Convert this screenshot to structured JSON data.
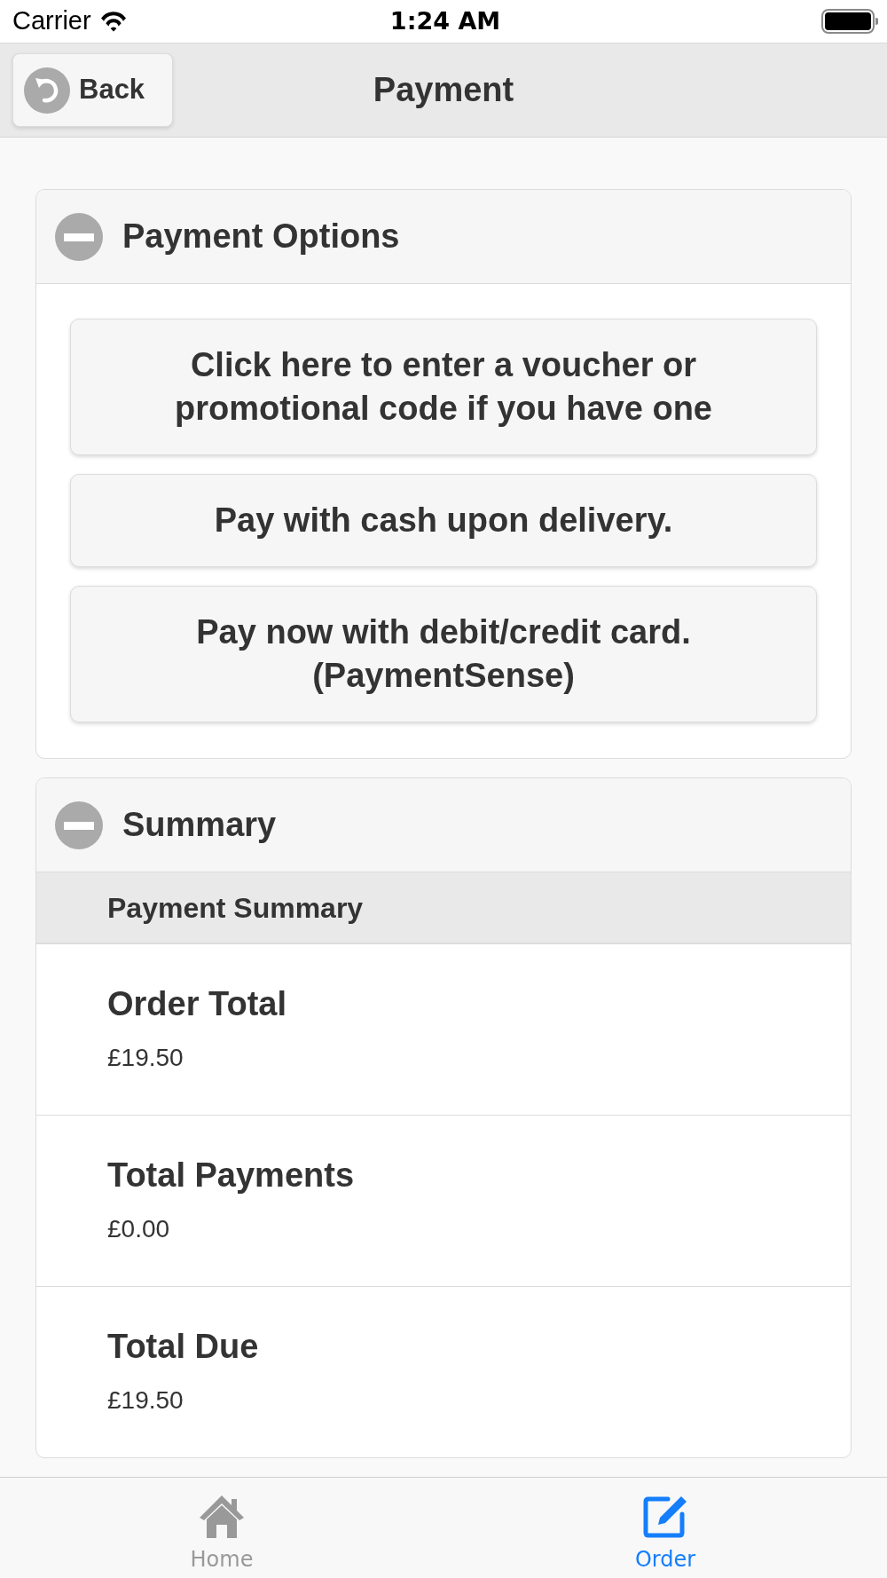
{
  "status_bar": {
    "carrier": "Carrier",
    "time": "1:24 AM"
  },
  "header": {
    "back_button": "Back",
    "title": "Payment"
  },
  "sections": [
    {
      "kind": "buttons",
      "title": "Payment Options",
      "expanded": true,
      "buttons": [
        "Click here to enter a voucher or promotional code if you have one",
        "Pay with cash upon delivery.",
        "Pay now with debit/credit card. (PaymentSense)"
      ]
    },
    {
      "kind": "list",
      "title": "Summary",
      "expanded": true,
      "divider": "Payment Summary",
      "items": [
        {
          "label": "Order Total",
          "value": "£19.50"
        },
        {
          "label": "Total Payments",
          "value": "£0.00"
        },
        {
          "label": "Total Due",
          "value": "£19.50"
        }
      ]
    }
  ],
  "tab_bar": [
    {
      "kind": "home",
      "label": "Home",
      "selected": false
    },
    {
      "kind": "order",
      "label": "Order",
      "selected": true
    }
  ]
}
